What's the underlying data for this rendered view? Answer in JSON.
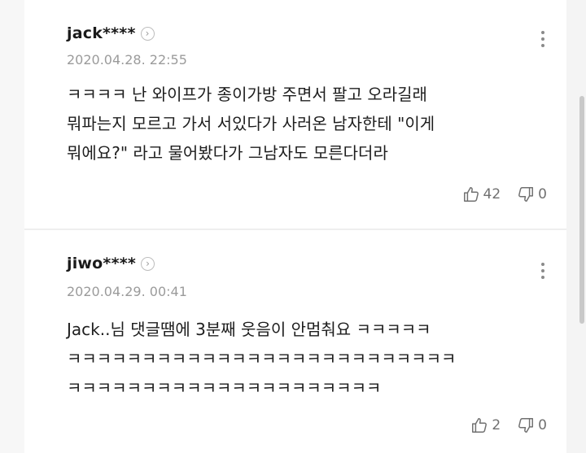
{
  "comments": [
    {
      "author": "jack****",
      "date": "2020.04.28. 22:55",
      "text": "ㅋㅋㅋㅋ 난 와이프가 종이가방 주면서 팔고 오라길래\n뭐파는지 모르고 가서 서있다가 사러온 남자한테 \"이게\n뭐에요?\" 라고 물어봤다가 그남자도 모른다더라",
      "likes": "42",
      "dislikes": "0"
    },
    {
      "author": "jiwo****",
      "date": "2020.04.29. 00:41",
      "text": "Jack..님 댓글땜에 3분째 웃음이 안멈춰요 ㅋㅋㅋㅋㅋ\nㅋㅋㅋㅋㅋㅋㅋㅋㅋㅋㅋㅋㅋㅋㅋㅋㅋㅋㅋㅋㅋㅋㅋㅋㅋㅋ\nㅋㅋㅋㅋㅋㅋㅋㅋㅋㅋㅋㅋㅋㅋㅋㅋㅋㅋㅋㅋㅋ",
      "likes": "2",
      "dislikes": "0"
    }
  ],
  "icons": {
    "profile": "chevron-right-icon",
    "more": "more-vertical-icon",
    "like": "thumbs-up-icon",
    "dislike": "thumbs-down-icon"
  }
}
